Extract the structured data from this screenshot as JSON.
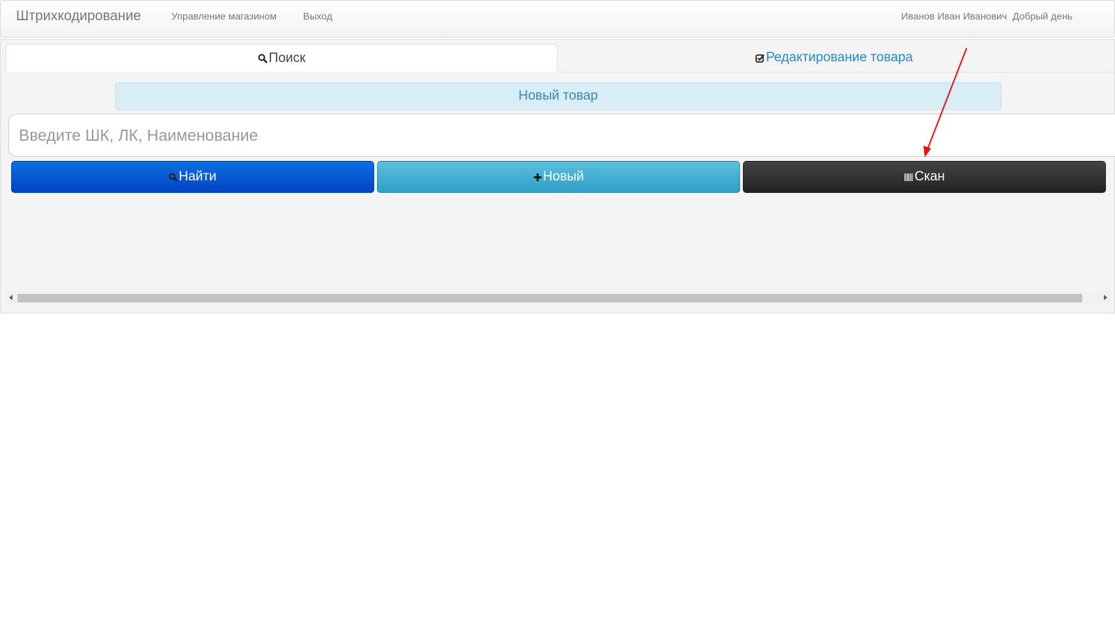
{
  "navbar": {
    "brand": "Штрихкодирование",
    "links": [
      "Управление магазином",
      "Выход"
    ],
    "user_name": "Иванов Иван Иванович",
    "greeting": "Добрый день"
  },
  "tabs": [
    {
      "label": "Поиск",
      "icon": "search-icon",
      "active": true
    },
    {
      "label": "Редактирование товара",
      "icon": "check-square-icon",
      "active": false
    }
  ],
  "info_banner": "Новый товар",
  "search": {
    "placeholder": "Введите ШК, ЛК, Наименование",
    "value": ""
  },
  "buttons": {
    "find": {
      "label": "Найти",
      "icon": "search-icon"
    },
    "new": {
      "label": "Новый",
      "icon": "plus-icon"
    },
    "scan": {
      "label": "Скан",
      "icon": "barcode-icon"
    }
  },
  "colors": {
    "find_button": "#0055d4",
    "new_button": "#45b0d4",
    "scan_button": "#333333",
    "link_blue": "#2a88c8",
    "banner_bg": "#d9edf7",
    "annotation_arrow": "#ee1111"
  }
}
